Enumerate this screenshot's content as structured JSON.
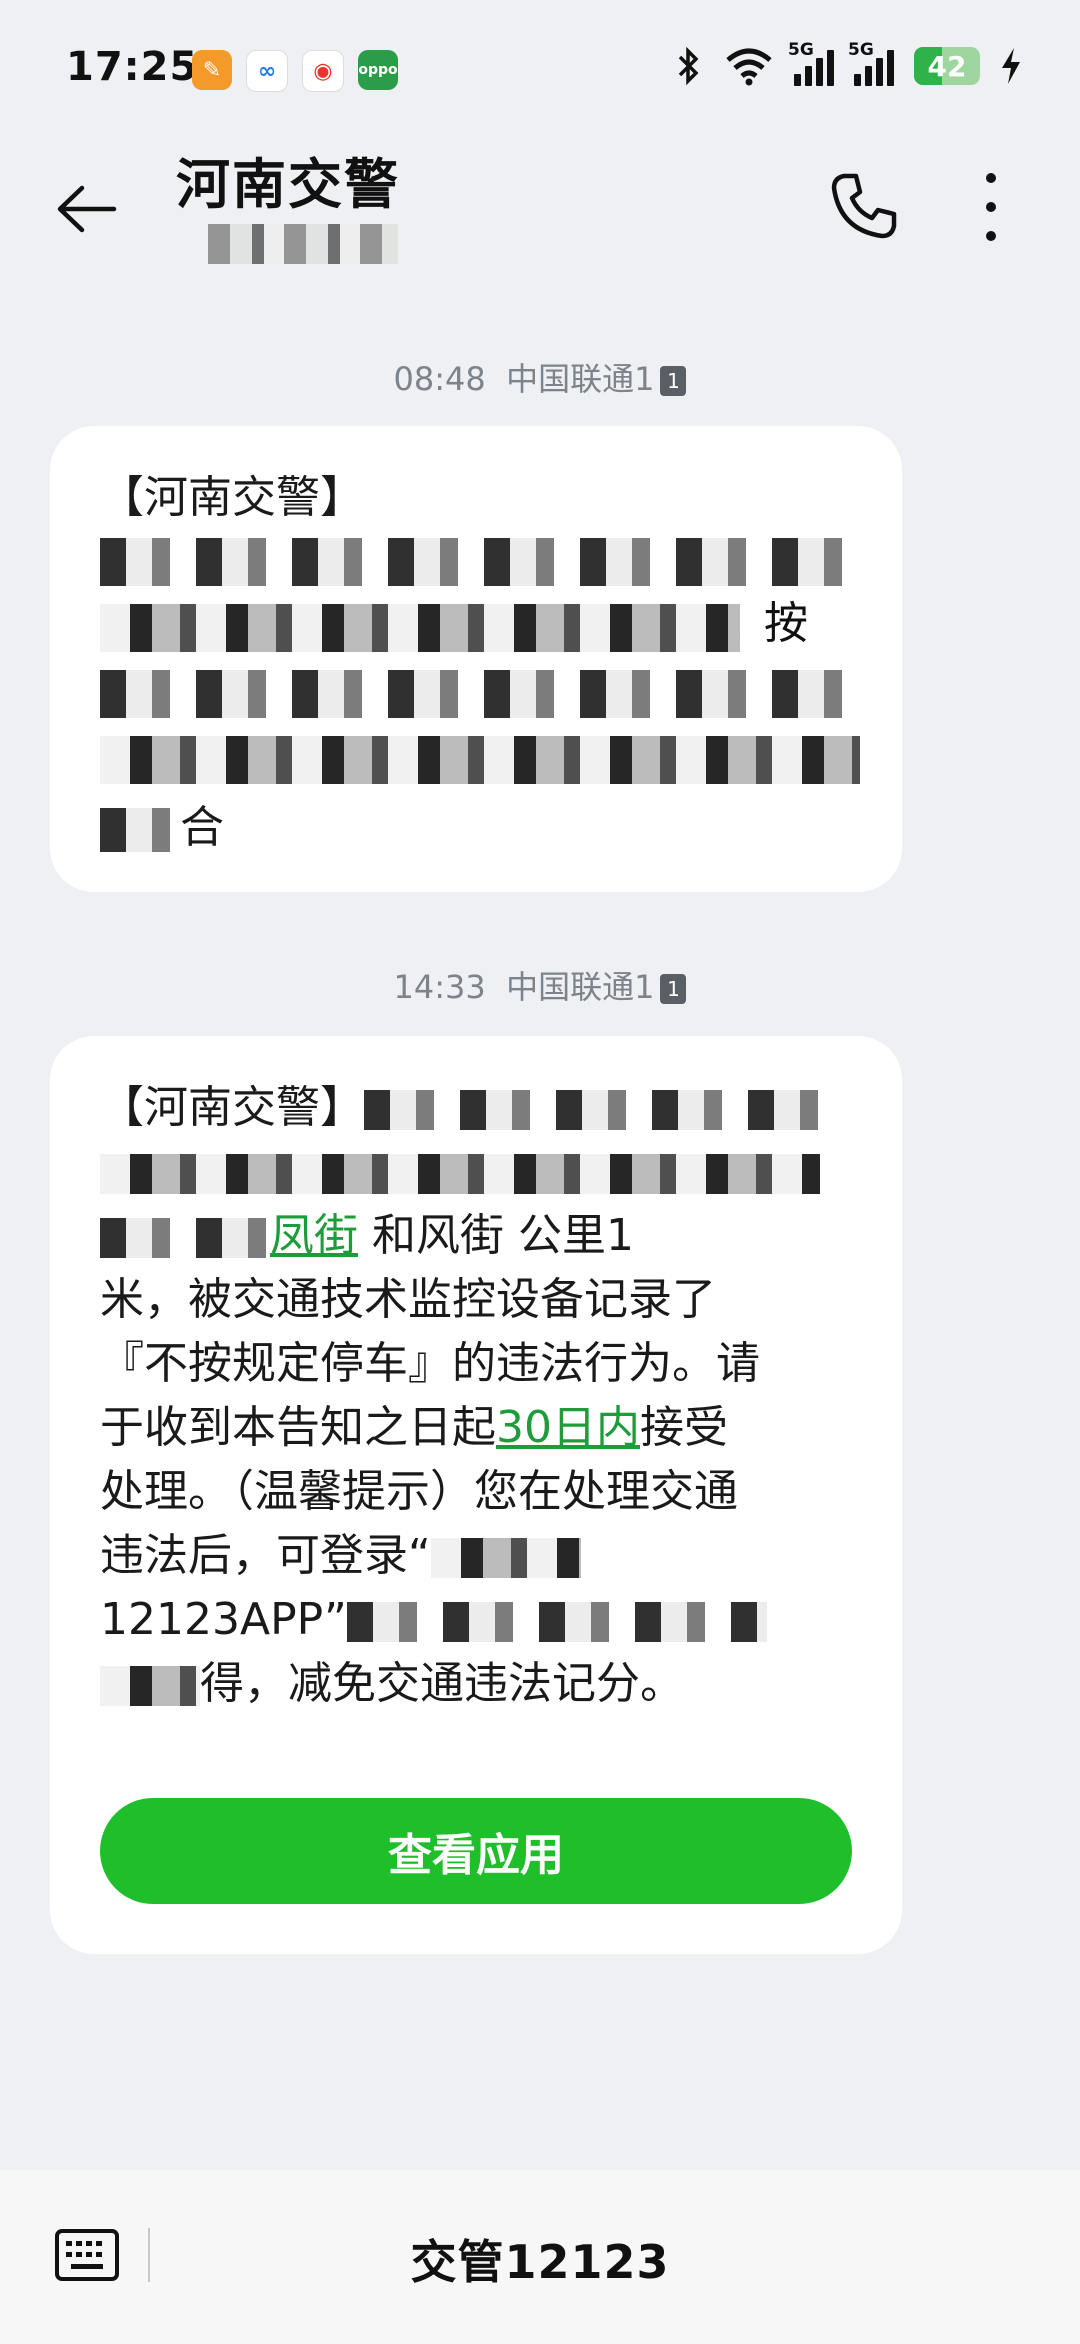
{
  "status_bar": {
    "time": "17:25",
    "app_icons": [
      "app-icon-orange",
      "app-icon-blue",
      "weibo-icon",
      "oppo-icon"
    ],
    "oppo_label": "oppo",
    "signal1_label": "5G",
    "signal2_label": "5G",
    "battery": "42",
    "battery_level_percent": 42,
    "icons": [
      "bluetooth-icon",
      "wifi-icon",
      "charging-icon"
    ]
  },
  "header": {
    "title": "河南交警",
    "icons": [
      "back-arrow-icon",
      "phone-icon",
      "more-icon"
    ]
  },
  "messages": [
    {
      "time": "08:48",
      "carrier": "中国联通1",
      "sim": "1",
      "visible_fragments": [
        "【河南交警】",
        "按",
        "合"
      ]
    },
    {
      "time": "14:33",
      "carrier": "中国联通1",
      "sim": "1",
      "lines": [
        {
          "text": "【河南交警】"
        },
        {
          "link": "凤街",
          "text": " 和风街  公里1"
        },
        {
          "text": "米，被交通技术监控设备记录了"
        },
        {
          "text": "『不按规定停车』的违法行为。请"
        },
        {
          "pre": "于收到本告知之日起",
          "link": "30日内",
          "post": "接受"
        },
        {
          "text": "处理。（温馨提示）您在处理交通"
        },
        {
          "text": "违法后，可登录“"
        },
        {
          "text": "12123APP”"
        },
        {
          "text": "得，减免交通违法记分。"
        }
      ],
      "button_label": "查看应用"
    }
  ],
  "bottom_bar": {
    "sender": "交管12123",
    "icon": "keyboard-icon"
  },
  "colors": {
    "background": "#eef0f3",
    "bubble": "#ffffff",
    "accent_green": "#1fbf2c",
    "link_green": "#1f9c3a",
    "battery_green": "#2fb24a"
  }
}
